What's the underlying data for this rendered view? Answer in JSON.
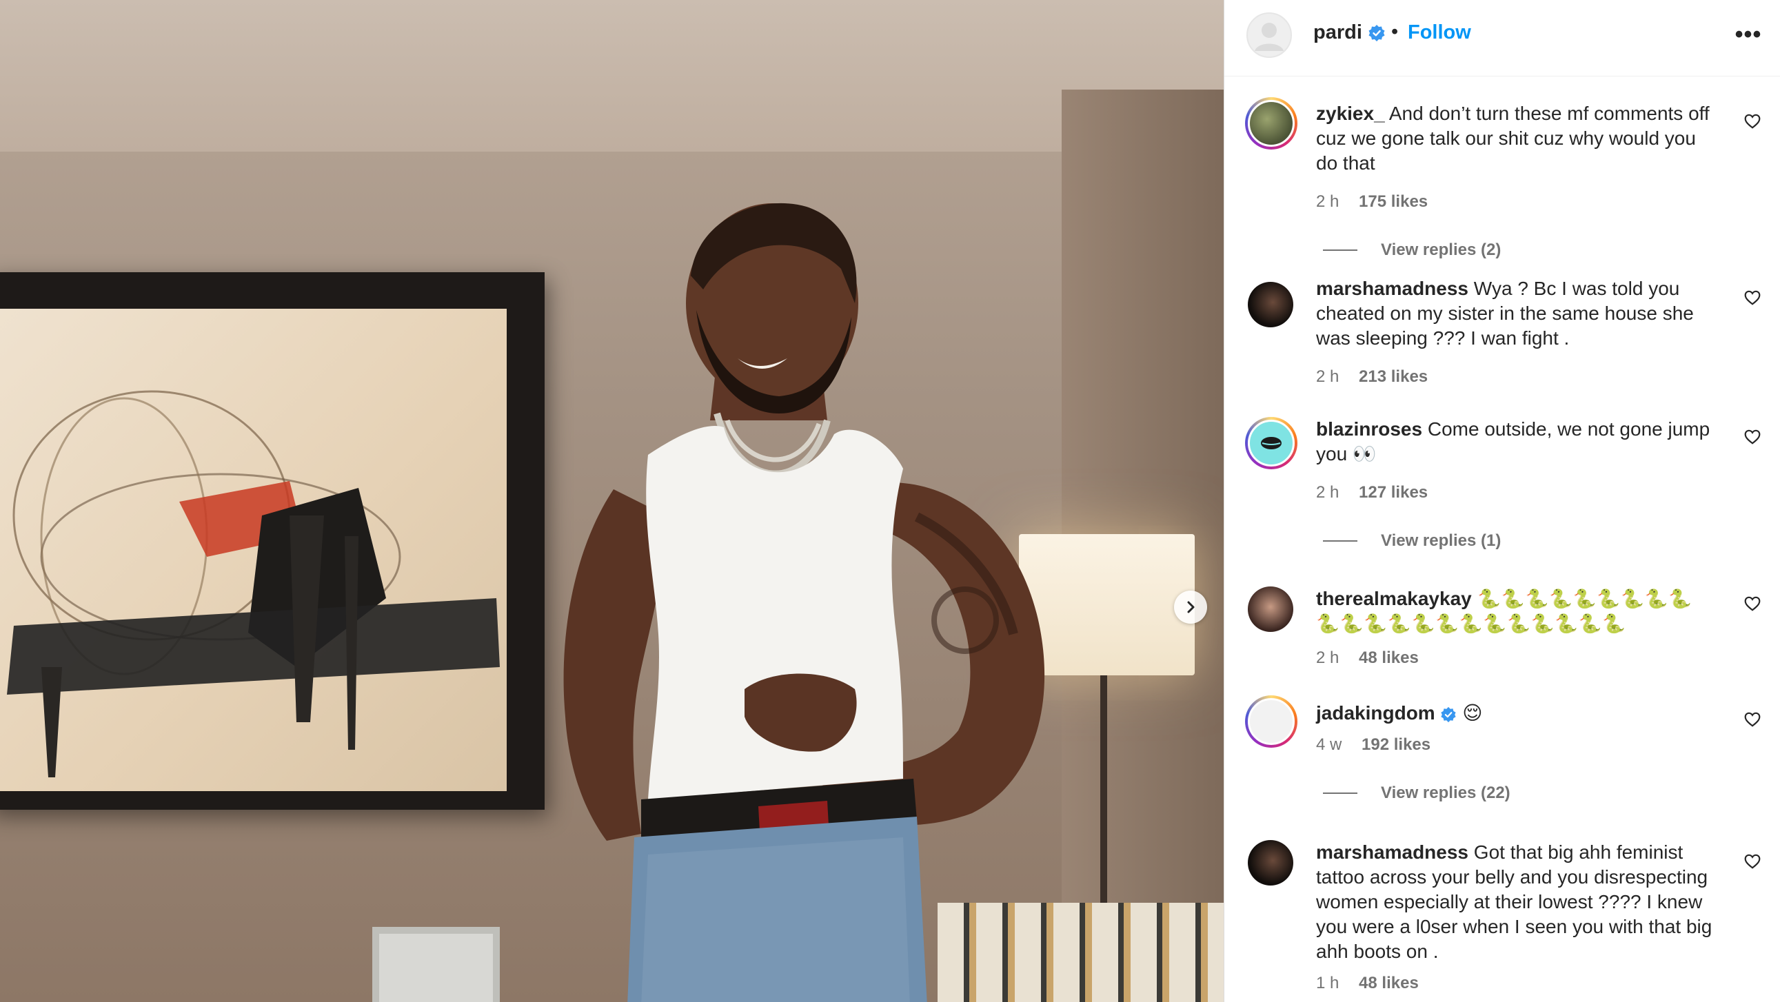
{
  "header": {
    "username": "pardi",
    "separator": "•",
    "follow_label": "Follow",
    "more_label": "•••"
  },
  "comments": [
    {
      "username": "zykiex_",
      "text": "And don’t turn these mf comments off cuz we gone talk our shit cuz why would you do that",
      "time": "2 h",
      "likes": "175 likes",
      "replies": "View replies (2)"
    },
    {
      "username": "marshamadness",
      "text": "Wya ? Bc I was told you cheated on my sister in the same house she was sleeping ??? I wan fight .",
      "time": "2 h",
      "likes": "213 likes"
    },
    {
      "username": "blazinroses",
      "text": "Come outside, we not gone jump you 👀",
      "time": "2 h",
      "likes": "127 likes",
      "replies": "View replies (1)"
    },
    {
      "username": "therealmakaykay",
      "text": "🐍🐍🐍🐍🐍🐍🐍🐍🐍🐍🐍🐍🐍🐍🐍🐍🐍🐍🐍🐍🐍🐍",
      "time": "2 h",
      "likes": "48 likes"
    },
    {
      "username": "jadakingdom",
      "text": "😌",
      "time": "4 w",
      "likes": "192 likes",
      "replies": "View replies (22)"
    },
    {
      "username": "marshamadness",
      "text": "Got that big ahh feminist tattoo across your belly and you disrespecting women especially at their lowest ???? I knew you were a l0ser when I seen you with that big ahh boots on .",
      "time": "1 h",
      "likes": "48 likes"
    }
  ],
  "icons": {
    "verified": "verified-badge-icon",
    "heart": "heart-outline-icon",
    "next": "chevron-right-icon",
    "more": "more-options-icon"
  },
  "colors": {
    "link_blue": "#0095f6",
    "verified_blue": "#3897f0",
    "meta_gray": "#737373",
    "text": "#262626"
  }
}
